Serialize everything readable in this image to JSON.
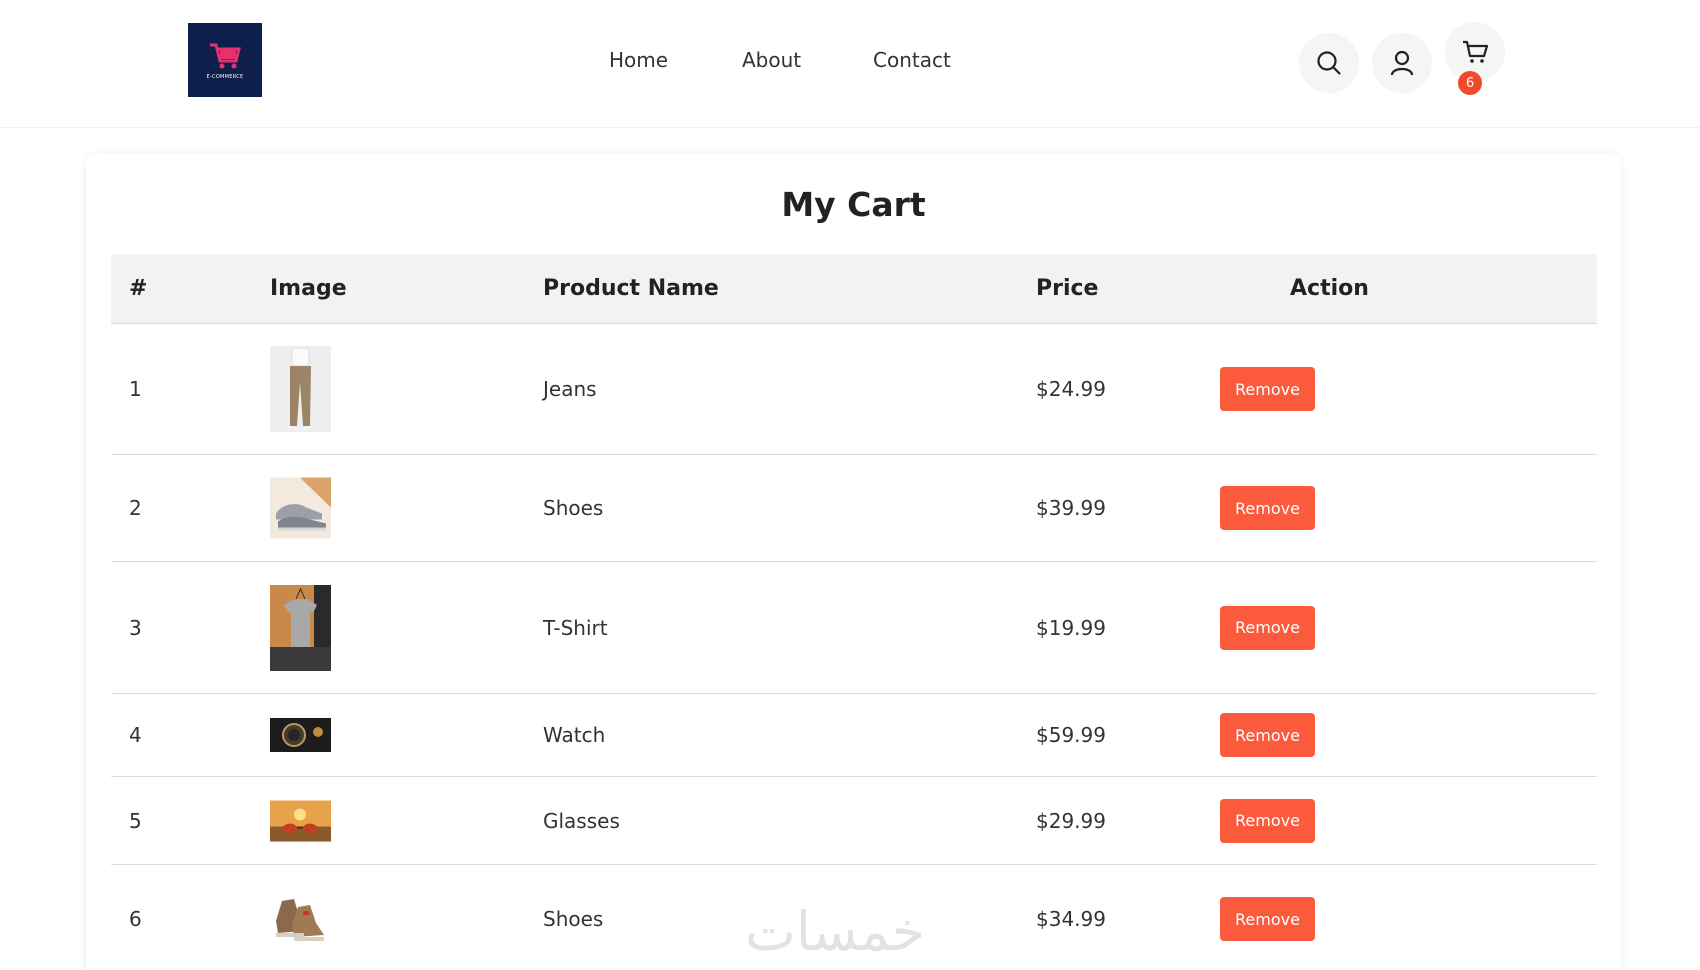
{
  "brand": {
    "logo_text": "E-COMMERCE",
    "logo_color": "#0f1f4b",
    "cart_color": "#e7306e"
  },
  "nav": {
    "home": "Home",
    "about": "About",
    "contact": "Contact"
  },
  "header_icons": {
    "search": "search-icon",
    "user": "user-icon",
    "cart": "cart-icon",
    "cart_count": "6"
  },
  "cart": {
    "title": "My Cart",
    "columns": {
      "index": "#",
      "image": "Image",
      "name": "Product Name",
      "price": "Price",
      "action": "Action"
    },
    "rows": [
      {
        "index": "1",
        "name": "Jeans",
        "price": "$24.99",
        "action": "Remove"
      },
      {
        "index": "2",
        "name": "Shoes",
        "price": "$39.99",
        "action": "Remove"
      },
      {
        "index": "3",
        "name": "T-Shirt",
        "price": "$19.99",
        "action": "Remove"
      },
      {
        "index": "4",
        "name": "Watch",
        "price": "$59.99",
        "action": "Remove"
      },
      {
        "index": "5",
        "name": "Glasses",
        "price": "$29.99",
        "action": "Remove"
      },
      {
        "index": "6",
        "name": "Shoes",
        "price": "$34.99",
        "action": "Remove"
      }
    ]
  },
  "colors": {
    "accent": "#fb5a3c",
    "badge": "#f04a2c",
    "header_bg": "#f2f2f2"
  },
  "watermark": "خمسات"
}
